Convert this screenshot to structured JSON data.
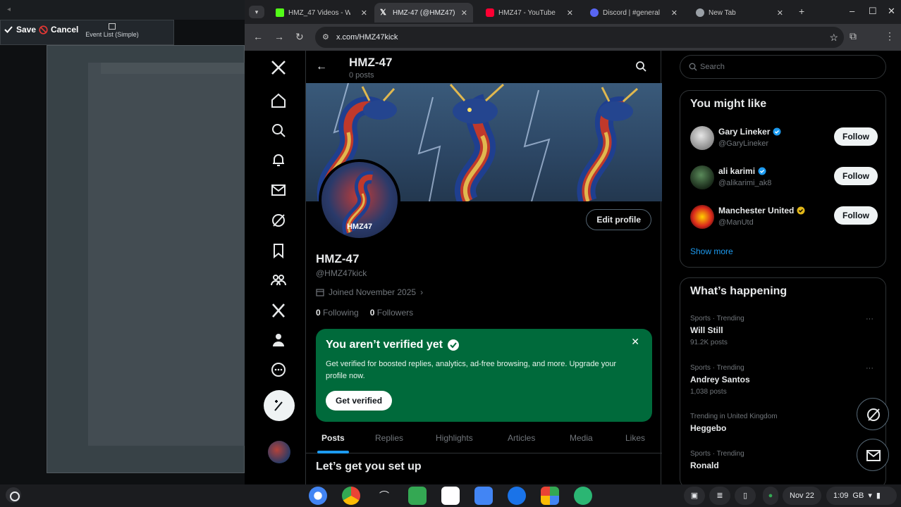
{
  "overlay": {
    "save_label": "Save",
    "cancel_label": "Cancel",
    "event_list_label": "Event List (Simple)"
  },
  "browser": {
    "tabs": [
      {
        "label": "HMZ_47 Videos - W",
        "favicon": "kick-icon",
        "color": "#53fc18"
      },
      {
        "label": "HMZ-47 (@HMZ47)",
        "favicon": "x-icon",
        "color": "#ffffff"
      },
      {
        "label": "HMZ47 - YouTube",
        "favicon": "youtube-icon",
        "color": "#ff0033"
      },
      {
        "label": "Discord | #general",
        "favicon": "discord-icon",
        "color": "#5865f2"
      },
      {
        "label": "New Tab",
        "favicon": "chrome-icon",
        "color": "#9aa0a6"
      }
    ],
    "url": "x.com/HMZ47kick"
  },
  "profile_header": {
    "title": "HMZ-47",
    "post_count": "0 posts"
  },
  "profile": {
    "avatar_mark": "HMZ47",
    "edit_label": "Edit profile",
    "name": "HMZ-47",
    "handle": "@HMZ47kick",
    "joined": "Joined November 2025",
    "following_count": "0",
    "following_label": "Following",
    "followers_count": "0",
    "followers_label": "Followers"
  },
  "verify": {
    "title": "You aren’t verified yet",
    "body": "Get verified for boosted replies, analytics, ad-free browsing, and more. Upgrade your profile now.",
    "button": "Get verified"
  },
  "profile_tabs": [
    "Posts",
    "Replies",
    "Highlights",
    "Articles",
    "Media",
    "Likes"
  ],
  "setup_heading": "Let’s get you set up",
  "sidebar": {
    "search_placeholder": "Search",
    "might_like_title": "You might like",
    "suggestions": [
      {
        "name": "Gary Lineker",
        "handle": "@GaryLineker",
        "verified": "blue",
        "follow": "Follow"
      },
      {
        "name": "ali karimi",
        "handle": "@alikarimi_ak8",
        "verified": "blue",
        "follow": "Follow"
      },
      {
        "name": "Manchester United",
        "handle": "@ManUtd",
        "verified": "gold",
        "follow": "Follow"
      }
    ],
    "show_more": "Show more",
    "happening_title": "What’s happening",
    "trends": [
      {
        "context": "Sports · Trending",
        "title": "Will Still",
        "posts": "91.2K posts"
      },
      {
        "context": "Sports · Trending",
        "title": "Andrey Santos",
        "posts": "1,038 posts"
      },
      {
        "context": "Trending in United Kingdom",
        "title": "Heggebo",
        "posts": ""
      },
      {
        "context": "Sports · Trending",
        "title": "Ronald",
        "posts": ""
      }
    ]
  },
  "shelf": {
    "date": "Nov 22",
    "time": "1:09",
    "region": "GB"
  }
}
